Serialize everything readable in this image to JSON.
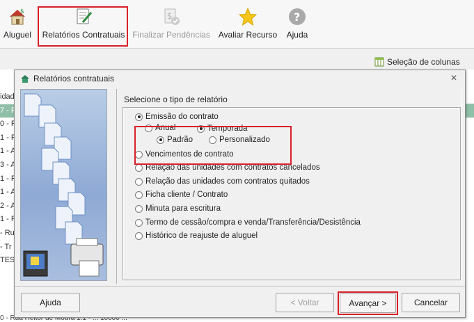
{
  "toolbar": {
    "items": [
      {
        "label": "Aluguel",
        "icon": "house-dollar-icon"
      },
      {
        "label": "Relatórios Contratuais",
        "icon": "report-pen-icon"
      },
      {
        "label": "Finalizar Pendências",
        "icon": "dollar-check-icon",
        "disabled": true
      },
      {
        "label": "Avaliar Recurso",
        "icon": "star-icon"
      },
      {
        "label": "Ajuda",
        "icon": "question-icon"
      }
    ],
    "column_selection": "Seleção de colunas"
  },
  "background_table": {
    "left_rows": [
      "idad",
      "7 - R",
      "0 - R",
      "1 - R",
      "1 - A",
      "3 - A",
      "1 - R",
      "1 - A",
      "2 - A",
      "1 - R",
      "- Ru",
      "- Tr",
      "TES"
    ],
    "bottom_row": "0 - Rua Heitor de Moura        1.1 - ...        10000 ..."
  },
  "dialog": {
    "title": "Relatórios contratuais",
    "prompt": "Selecione o tipo de relatório",
    "options": [
      {
        "label": "Emissão do contrato",
        "checked": true
      },
      {
        "label": "Vencimentos de contrato",
        "checked": false
      },
      {
        "label": "Relação das unidades com contratos cancelados",
        "checked": false
      },
      {
        "label": "Relação das unidades com contratos quitados",
        "checked": false
      },
      {
        "label": "Ficha cliente / Contrato",
        "checked": false
      },
      {
        "label": "Minuta para escritura",
        "checked": false
      },
      {
        "label": "Termo de cessão/compra e venda/Transferência/Desistência",
        "checked": false
      },
      {
        "label": "Histórico de reajuste de aluguel",
        "checked": false
      }
    ],
    "sub_options": {
      "anual": {
        "label": "Anual",
        "checked": false
      },
      "temporada": {
        "label": "Temporada",
        "checked": true
      },
      "padrao": {
        "label": "Padrão",
        "checked": true
      },
      "personalizado": {
        "label": "Personalizado",
        "checked": false
      }
    },
    "buttons": {
      "help": "Ajuda",
      "back": "< Voltar",
      "next": "Avançar >",
      "cancel": "Cancelar"
    }
  },
  "colors": {
    "highlight": "#d9202a",
    "selected_row": "#8fbfa7"
  }
}
